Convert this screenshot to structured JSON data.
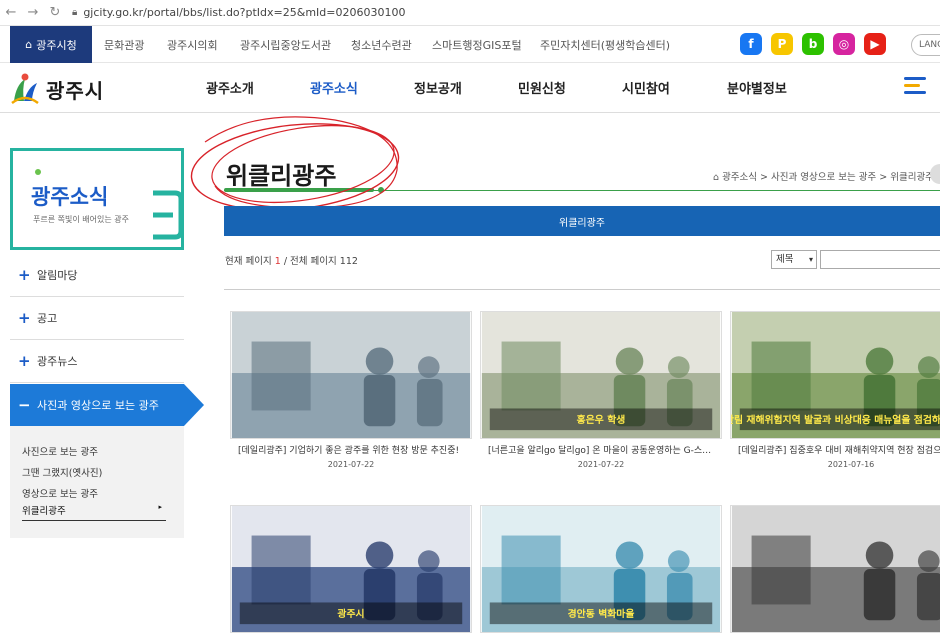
{
  "browser": {
    "url": "gjcity.go.kr/portal/bbs/list.do?ptIdx=25&mId=0206030100",
    "back_icon": "arrow-left-icon",
    "forward_icon": "arrow-right-icon",
    "reload_icon": "reload-icon"
  },
  "utility_bar": {
    "home_label": "광주시청",
    "links": [
      "문화관광",
      "광주시의회",
      "광주시립중앙도서관",
      "청소년수련관",
      "스마트행정GIS포털",
      "주민자치센터(평생학습센터)"
    ],
    "sns": [
      {
        "name": "facebook-icon",
        "glyph": "f",
        "color": "#1877f2"
      },
      {
        "name": "kakaostory-icon",
        "glyph": "P",
        "color": "#f7c600"
      },
      {
        "name": "band-icon",
        "glyph": "b",
        "color": "#2dc100"
      },
      {
        "name": "instagram-icon",
        "glyph": "◎",
        "color": "#d6249f"
      },
      {
        "name": "youtube-icon",
        "glyph": "▶",
        "color": "#e62117"
      }
    ],
    "lang_label": "LANG"
  },
  "header": {
    "logo_text": "광주시",
    "menu": [
      "광주소개",
      "광주소식",
      "정보공개",
      "민원신청",
      "시민참여",
      "분야별정보"
    ],
    "active_menu": "광주소식"
  },
  "sidebar": {
    "banner_title": "광주소식",
    "banner_sub": "푸르른 쪽빛이 배어있는 광주",
    "items": [
      "알림마당",
      "공고",
      "광주뉴스"
    ],
    "active_item": "사진과 영상으로 보는 광주",
    "sub_items": [
      "사진으로 보는 광주",
      "그땐 그랬지(옛사진)",
      "영상으로 보는 광주"
    ],
    "active_sub_item": "위클리광주",
    "sub_arrow": "▸"
  },
  "content": {
    "page_title": "위클리광주",
    "breadcrumb": "광주소식 > 사진과 영상으로 보는 광주 > 위클리광주",
    "home_icon": "home-icon",
    "tab_label": "위클리광주",
    "page_count_prefix": "현재 페이지 ",
    "current_page": "1",
    "page_count_suffix": " / 전체 페이지 112",
    "search_select_value": "제목",
    "search_input_value": ""
  },
  "cards": [
    {
      "title": "[데일리광주] 기업하기 좋은 광주를 위한 현장 방문 추진중!",
      "date": "2021-07-22",
      "palette": [
        "#5a6f7e",
        "#8fa3b0",
        "#c9d2d6"
      ],
      "caption": ""
    },
    {
      "title": "[너른고을 알리go 달리go] 온 마을이 공동운영하는 G-스포츠클럽",
      "date": "2021-07-22",
      "palette": [
        "#6f8a60",
        "#a9b39a",
        "#e4e4dc"
      ],
      "caption": "홍은우 학생"
    },
    {
      "title": "[데일리광주] 집중호우 대비 재해취약지역 현장 점검으로",
      "date": "2021-07-16",
      "palette": [
        "#4f7a3d",
        "#8aa56b",
        "#c4cfb0"
      ],
      "caption": "산림 재해위험지역 발굴과 비상대응 매뉴얼을 점검하였습니다"
    },
    {
      "title": "",
      "date": "",
      "palette": [
        "#2b3f6e",
        "#5a6f9c",
        "#e3e6ee"
      ],
      "caption": "광주시"
    },
    {
      "title": "",
      "date": "",
      "palette": [
        "#3e8fb0",
        "#9ec8d6",
        "#e0eef2"
      ],
      "caption": "경안동 벽화마을"
    },
    {
      "title": "",
      "date": "",
      "palette": [
        "#3a3a3a",
        "#7a7a7a",
        "#d5d5d5"
      ],
      "caption": ""
    }
  ]
}
